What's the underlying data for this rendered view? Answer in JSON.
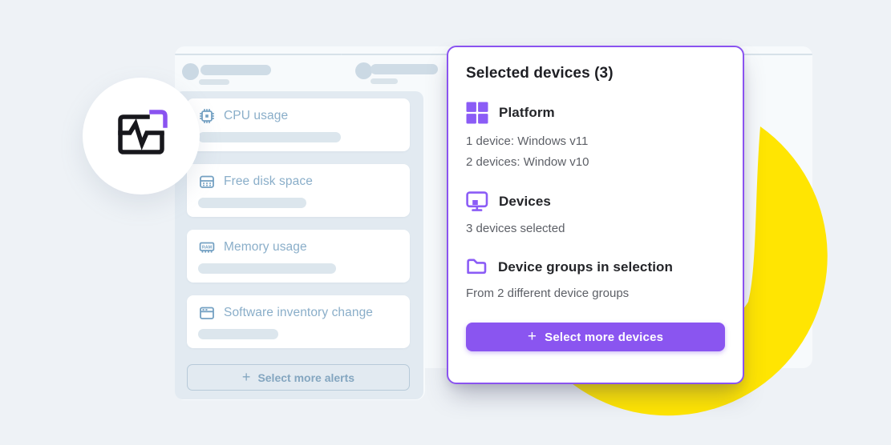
{
  "alerts_panel": {
    "select_more_label": "Select more alerts",
    "plus_glyph": "+",
    "items": [
      {
        "icon": "cpu-chip",
        "label": "CPU usage"
      },
      {
        "icon": "disk-drive",
        "label": "Free disk space"
      },
      {
        "icon": "ram-module",
        "label": "Memory usage"
      },
      {
        "icon": "app-window",
        "label": "Software inventory change"
      }
    ]
  },
  "devices_panel": {
    "title": "Selected devices (3)",
    "plus_glyph": "+",
    "button_label": "Select more devices",
    "sections": [
      {
        "icon": "windows-grid",
        "heading": "Platform",
        "lines": [
          "1 device: Windows v11",
          "2 devices: Window v10"
        ]
      },
      {
        "icon": "monitor",
        "heading": "Devices",
        "lines": [
          "3 devices selected"
        ]
      },
      {
        "icon": "folder",
        "heading": "Device groups in selection",
        "lines": [
          "From 2 different device groups"
        ]
      }
    ]
  },
  "colors": {
    "accent_purple": "#8a55f0",
    "accent_yellow": "#ffe502",
    "muted_blue": "#74a1c3",
    "panel_gray_blue": "#e2eaf1",
    "background": "#eef2f6"
  },
  "ram_icon_text": "RAM"
}
